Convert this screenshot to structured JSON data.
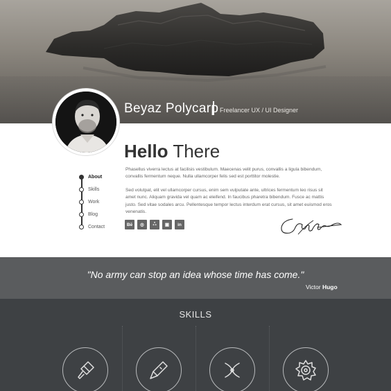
{
  "profile": {
    "name": "Beyaz Polycarp",
    "role": "Freelancer UX / UI Designer"
  },
  "about": {
    "heading_bold": "Hello",
    "heading_light": " There",
    "paragraph_1": "Phasellus viverra lectus at facilisis vestibulum. Maecenas velit purus, convallis a ligula bibendum, convallis fermentum neque. Nulla ullamcorper felis sed est porttitor molestie.",
    "paragraph_2": "Sed volutpat, elit vel ullamcorper cursus, enim sem vulputate ante, ultrices fermentum leo risus sit amet nunc. Aliquam gravida vel quam ac eleifend. In faucibus pharetra bibendum. Fusce ac mattis justo. Sed vitae sodales arcu. Pellentesque tempor lectus interdum erat cursus, sit amet euismod eros venenatis."
  },
  "nav": {
    "items": [
      {
        "label": "About",
        "active": true
      },
      {
        "label": "Skills",
        "active": false
      },
      {
        "label": "Work",
        "active": false
      },
      {
        "label": "Blog",
        "active": false
      },
      {
        "label": "Contact",
        "active": false
      }
    ]
  },
  "social": {
    "items": [
      {
        "icon": "behance-icon",
        "glyph": "Bē"
      },
      {
        "icon": "dribbble-icon",
        "glyph": "◎"
      },
      {
        "icon": "myspace-icon",
        "glyph": "ஃ"
      },
      {
        "icon": "instagram-icon",
        "glyph": "▣"
      },
      {
        "icon": "linkedin-icon",
        "glyph": "in"
      }
    ]
  },
  "quote": {
    "text": "\"No army can stop an idea whose time has come.\"",
    "author_first": "Victor",
    "author_last": "Hugo"
  },
  "skills": {
    "title": "SKILLS",
    "icons": [
      "paintbrush-icon",
      "utility-knife-icon",
      "pliers-icon",
      "saw-blade-icon"
    ]
  },
  "colors": {
    "quote_band": "#5a5c5e",
    "skills_bg": "#3e4144",
    "text_dark": "#333333"
  }
}
